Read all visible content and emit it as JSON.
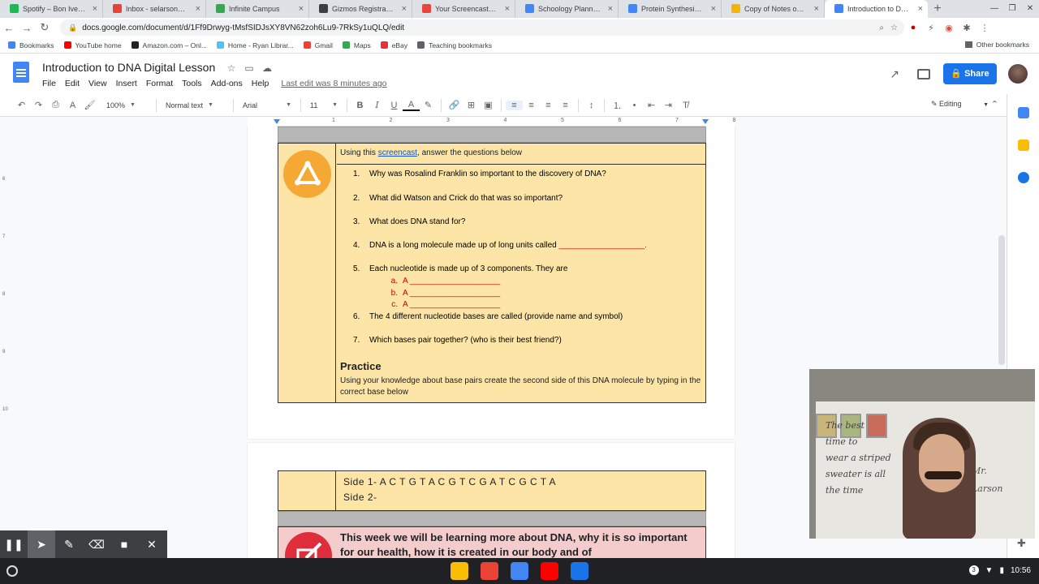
{
  "browser": {
    "tabs": [
      {
        "label": "Spotify – Bon Iver Radio",
        "color": "#1db954"
      },
      {
        "label": "Inbox - selarson@guhsd",
        "color": "#ea4335"
      },
      {
        "label": "Infinite Campus",
        "color": "#34a853"
      },
      {
        "label": "Gizmos Registration | S",
        "color": "#3c4043"
      },
      {
        "label": "Your Screencasts - Scre",
        "color": "#e8453c"
      },
      {
        "label": "Schoology Planning Sy",
        "color": "#4285f4"
      },
      {
        "label": "Protein Synthesis and",
        "color": "#4285f4"
      },
      {
        "label": "Copy of Notes on DNA",
        "color": "#f4b400"
      },
      {
        "label": "Introduction to DNA Dig",
        "color": "#4285f4"
      }
    ],
    "url": "docs.google.com/document/d/1Ff9Drwyg-tMsfSIDJsXY8VN62zoh6Lu9-7RkSy1uQLQ/edit",
    "bookmarks": [
      {
        "label": "Bookmarks",
        "color": "#4285f4"
      },
      {
        "label": "YouTube home",
        "color": "#ff0000"
      },
      {
        "label": "Amazon.com – Onl...",
        "color": "#222222"
      },
      {
        "label": "Home - Ryan Librar...",
        "color": "#4fc3f7"
      },
      {
        "label": "Gmail",
        "color": "#ea4335"
      },
      {
        "label": "Maps",
        "color": "#34a853"
      },
      {
        "label": "eBay",
        "color": "#e53238"
      },
      {
        "label": "Teaching bookmarks",
        "color": "#5f6368"
      }
    ],
    "other_bookmarks": "Other bookmarks"
  },
  "docs": {
    "title": "Introduction to DNA Digital Lesson",
    "menus": [
      "File",
      "Edit",
      "View",
      "Insert",
      "Format",
      "Tools",
      "Add-ons",
      "Help"
    ],
    "last_edit": "Last edit was 8 minutes ago",
    "share_label": "Share",
    "toolbar": {
      "zoom": "100%",
      "style": "Normal text",
      "font": "Arial",
      "size": "11",
      "mode": "Editing"
    },
    "ruler_numbers": [
      "1",
      "2",
      "3",
      "4",
      "5",
      "6",
      "7",
      "8"
    ],
    "vertical_ruler": [
      "6",
      "7",
      "8",
      "9",
      "10"
    ]
  },
  "content": {
    "instruction_prefix": "Using this ",
    "instruction_link": "screencast",
    "instruction_suffix": ", answer the questions below",
    "questions": [
      {
        "n": "1.",
        "text": "Why was Rosalind Franklin so important to the discovery of DNA?"
      },
      {
        "n": "2.",
        "text": "What did Watson and Crick do that was so important?"
      },
      {
        "n": "3.",
        "text": "What does DNA stand for?"
      },
      {
        "n": "4.",
        "text": "DNA is a long molecule made up of long units called ",
        "blank": "___________________."
      },
      {
        "n": "5.",
        "text": "Each nucleotide is made up of 3 components. They are"
      },
      {
        "n": "6.",
        "text": "The 4 different nucleotide bases are called (provide name and symbol)"
      },
      {
        "n": "7.",
        "text": "Which bases pair together? (who is their best friend?)"
      }
    ],
    "sub_items": [
      {
        "n": "a.",
        "text": "A ____________________"
      },
      {
        "n": "b.",
        "text": "A ____________________"
      },
      {
        "n": "c.",
        "text": "A ____________________"
      }
    ],
    "practice_heading": "Practice",
    "practice_text": "Using your knowledge about base pairs create the second side of this DNA molecule by typing in the correct base below",
    "side1": "Side 1-  A   C   T   G   T   A   C   G   T   C   G   A   T   C   G   C   T   A",
    "side2": "Side 2-",
    "week_text": "This week we will be learning more about DNA, why it is so important for our health, how it is created in our body and of"
  },
  "webcam": {
    "board_left": "The best\ntime to\nwear a striped\nsweater is all\nthe time",
    "board_right": "Mr.\nLarson"
  },
  "taskbar": {
    "apps": [
      {
        "name": "chrome",
        "color": "#fbbc05"
      },
      {
        "name": "gmail",
        "color": "#ea4335"
      },
      {
        "name": "docs",
        "color": "#4285f4"
      },
      {
        "name": "youtube",
        "color": "#ff0000"
      },
      {
        "name": "files",
        "color": "#1a73e8"
      }
    ],
    "clock": "10:56",
    "badge": "3"
  }
}
